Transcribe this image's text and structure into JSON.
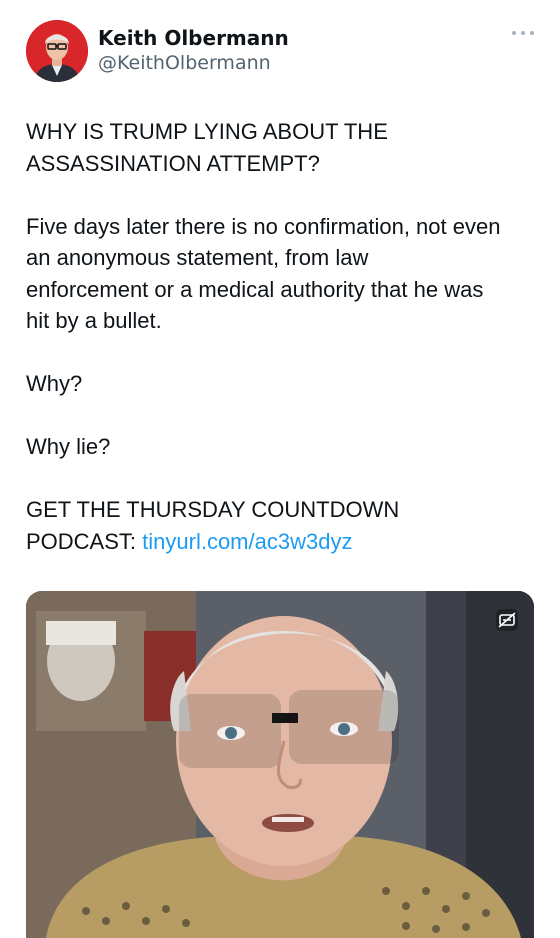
{
  "author": {
    "display_name": "Keith Olbermann",
    "handle": "@KeithOlbermann",
    "avatar_bg": "#d8262b"
  },
  "menu": {
    "icon": "more-icon"
  },
  "tweet": {
    "headline_line1": "WHY IS TRUMP LYING ABOUT THE",
    "headline_line2": "ASSASSINATION ATTEMPT?",
    "para_line1": "Five days later there is no confirmation, not even",
    "para_line2": "an anonymous statement, from law",
    "para_line3": "enforcement or a medical authority that he was",
    "para_line4": "hit by a bullet.",
    "why": "Why?",
    "why_lie": "Why lie?",
    "cta_line1": "GET THE THURSDAY COUNTDOWN",
    "cta_prefix": "PODCAST: ",
    "link_text": "tinyurl.com/ac3w3dyz",
    "link_color": "#1d9bf0"
  },
  "media": {
    "type": "video-thumbnail",
    "badge_icon": "closed-captions-icon"
  }
}
